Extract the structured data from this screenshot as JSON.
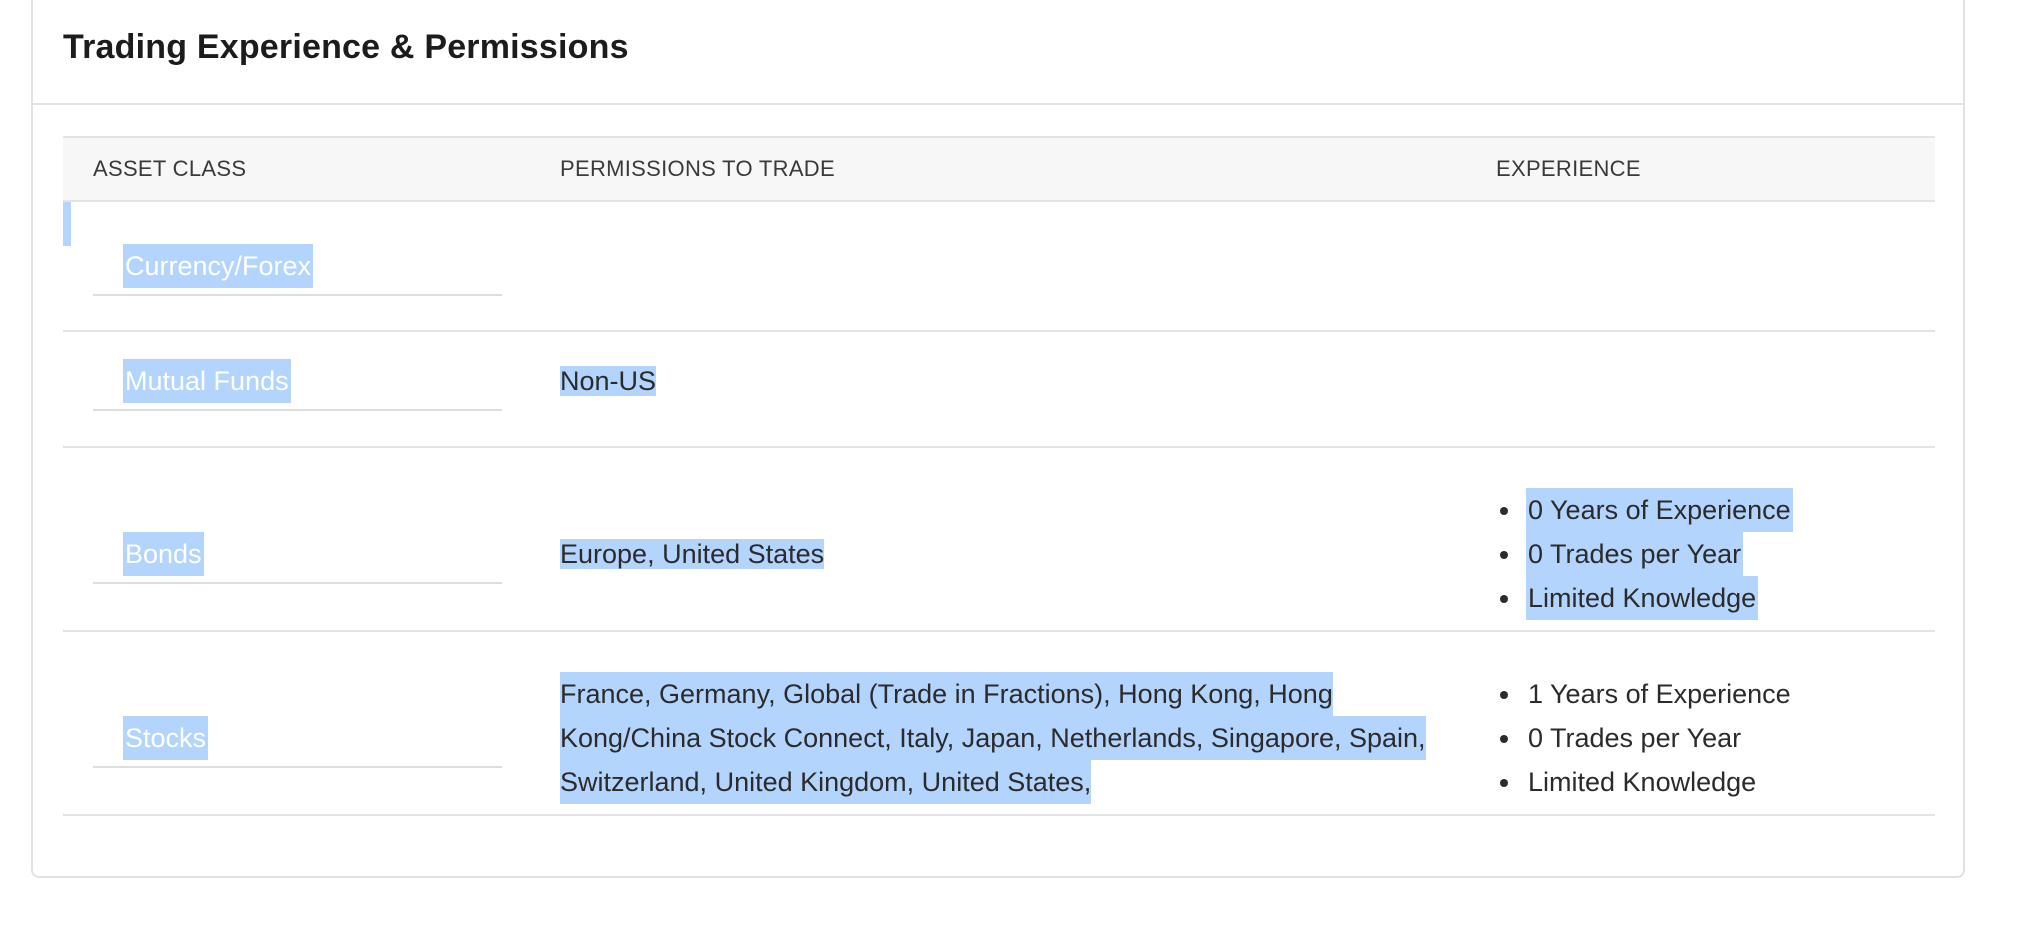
{
  "panel": {
    "title": "Trading Experience & Permissions"
  },
  "table": {
    "headers": {
      "asset_class": "ASSET CLASS",
      "permissions": "PERMISSIONS TO TRADE",
      "experience": "EXPERIENCE"
    },
    "rows": [
      {
        "asset_class": "Currency/Forex",
        "permissions": "",
        "experience": []
      },
      {
        "asset_class": "Mutual Funds",
        "permissions": "Non-US",
        "experience": []
      },
      {
        "asset_class": "Bonds",
        "permissions": "Europe, United States",
        "experience": [
          "0 Years of Experience",
          "0 Trades per Year",
          "Limited Knowledge"
        ]
      },
      {
        "asset_class": "Stocks",
        "permissions_lines": [
          "France, Germany, Global (Trade in Fractions), Hong Kong, Hong",
          "Kong/China Stock Connect, Italy, Japan, Netherlands, Singapore, Spain,",
          "Switzerland, United Kingdom, United States,"
        ],
        "experience": [
          "1 Years of Experience",
          "0 Trades per Year",
          "Limited Knowledge"
        ]
      }
    ]
  },
  "colors": {
    "selection": "#b3d4fd",
    "header_bg": "#f7f7f7",
    "border": "#e3e3e3"
  }
}
